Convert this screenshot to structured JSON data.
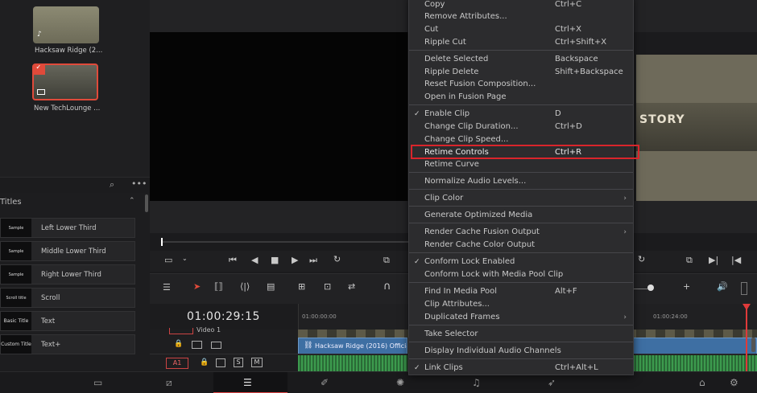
{
  "media_pool": {
    "clips": [
      {
        "name": "Hacksaw Ridge (2..."
      },
      {
        "name": "New TechLounge ..."
      }
    ]
  },
  "titles_panel": {
    "heading": "Titles",
    "items": [
      {
        "preview": "Sample",
        "label": "Left Lower Third"
      },
      {
        "preview": "Sample",
        "label": "Middle Lower Third"
      },
      {
        "preview": "Sample",
        "label": "Right Lower Third"
      },
      {
        "preview": "Scroll title",
        "label": "Scroll"
      },
      {
        "preview": "Basic Title",
        "label": "Text"
      },
      {
        "preview": "Custom Title",
        "label": "Text+"
      }
    ]
  },
  "viewer": {
    "overlay_text": "STORY"
  },
  "timeline": {
    "timecode": "01:00:29:15",
    "ruler_ticks": [
      "01:00:00:00",
      "01:00:24:00"
    ],
    "v1_label": "Video 1",
    "v1_track": "V1",
    "a1_track": "A1",
    "clip_name": "Hacksaw Ridge (2016) Officia"
  },
  "context_menu": {
    "items": [
      {
        "label": "Copy",
        "shortcut": "Ctrl+C"
      },
      {
        "label": "Remove Attributes...",
        "shortcut": ""
      },
      {
        "label": "Cut",
        "shortcut": "Ctrl+X"
      },
      {
        "label": "Ripple Cut",
        "shortcut": "Ctrl+Shift+X"
      },
      {
        "label": "Delete Selected",
        "shortcut": "Backspace"
      },
      {
        "label": "Ripple Delete",
        "shortcut": "Shift+Backspace"
      },
      {
        "label": "Reset Fusion Composition...",
        "shortcut": ""
      },
      {
        "label": "Open in Fusion Page",
        "shortcut": ""
      },
      {
        "label": "Enable Clip",
        "shortcut": "D"
      },
      {
        "label": "Change Clip Duration...",
        "shortcut": "Ctrl+D"
      },
      {
        "label": "Change Clip Speed...",
        "shortcut": ""
      },
      {
        "label": "Retime Controls",
        "shortcut": "Ctrl+R"
      },
      {
        "label": "Retime Curve",
        "shortcut": ""
      },
      {
        "label": "Normalize Audio Levels...",
        "shortcut": ""
      },
      {
        "label": "Clip Color",
        "shortcut": ""
      },
      {
        "label": "Generate Optimized Media",
        "shortcut": ""
      },
      {
        "label": "Render Cache Fusion Output",
        "shortcut": ""
      },
      {
        "label": "Render Cache Color Output",
        "shortcut": ""
      },
      {
        "label": "Conform Lock Enabled",
        "shortcut": ""
      },
      {
        "label": "Conform Lock with Media Pool Clip",
        "shortcut": ""
      },
      {
        "label": "Find In Media Pool",
        "shortcut": "Alt+F"
      },
      {
        "label": "Clip Attributes...",
        "shortcut": ""
      },
      {
        "label": "Duplicated Frames",
        "shortcut": ""
      },
      {
        "label": "Take Selector",
        "shortcut": ""
      },
      {
        "label": "Display Individual Audio Channels",
        "shortcut": ""
      },
      {
        "label": "Link Clips",
        "shortcut": "Ctrl+Alt+L"
      }
    ]
  },
  "icons": {
    "check": "✓",
    "submenu": "›"
  },
  "colors": {
    "highlight": "#d9252b",
    "clip_blue": "#3e6fa3",
    "audio_green": "#2e7b3e",
    "playhead": "#e03a3a"
  }
}
